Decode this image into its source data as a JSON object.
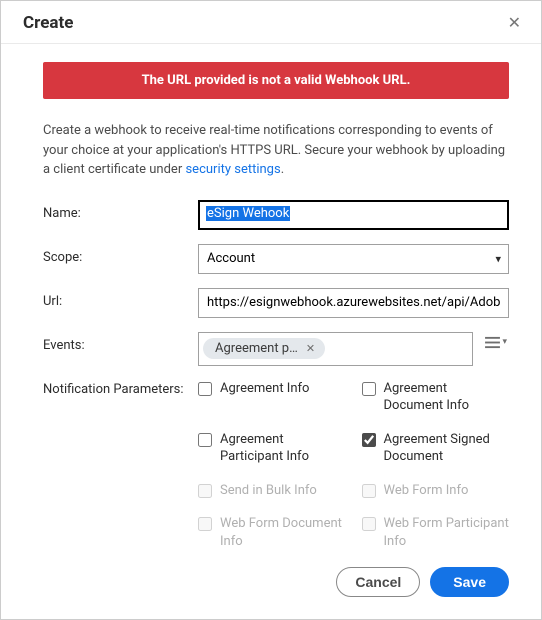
{
  "dialog": {
    "title": "Create",
    "error": "The URL provided is not a valid Webhook URL.",
    "intro_part1": "Create a webhook to receive real-time notifications corresponding to events of your choice at your application's HTTPS URL. Secure your webhook by uploading a client certificate under ",
    "intro_link": "security settings",
    "intro_part2": "."
  },
  "labels": {
    "name": "Name:",
    "scope": "Scope:",
    "url": "Url:",
    "events": "Events:",
    "params": "Notification Parameters:"
  },
  "fields": {
    "name_value": "eSign Wehook",
    "scope_value": "Account",
    "url_value": "https://esignwebhook.azurewebsites.net/api/AdobeES"
  },
  "event_tag": {
    "label": "Agreement p…"
  },
  "params": [
    {
      "label": "Agreement Info",
      "checked": false,
      "disabled": false
    },
    {
      "label": "Agreement Document Info",
      "checked": false,
      "disabled": false
    },
    {
      "label": "Agreement Participant Info",
      "checked": false,
      "disabled": false
    },
    {
      "label": "Agreement Signed Document",
      "checked": true,
      "disabled": false
    },
    {
      "label": "Send in Bulk Info",
      "checked": false,
      "disabled": true
    },
    {
      "label": "Web Form Info",
      "checked": false,
      "disabled": true
    },
    {
      "label": "Web Form Document Info",
      "checked": false,
      "disabled": true
    },
    {
      "label": "Web Form Participant Info",
      "checked": false,
      "disabled": true
    }
  ],
  "buttons": {
    "cancel": "Cancel",
    "save": "Save"
  }
}
